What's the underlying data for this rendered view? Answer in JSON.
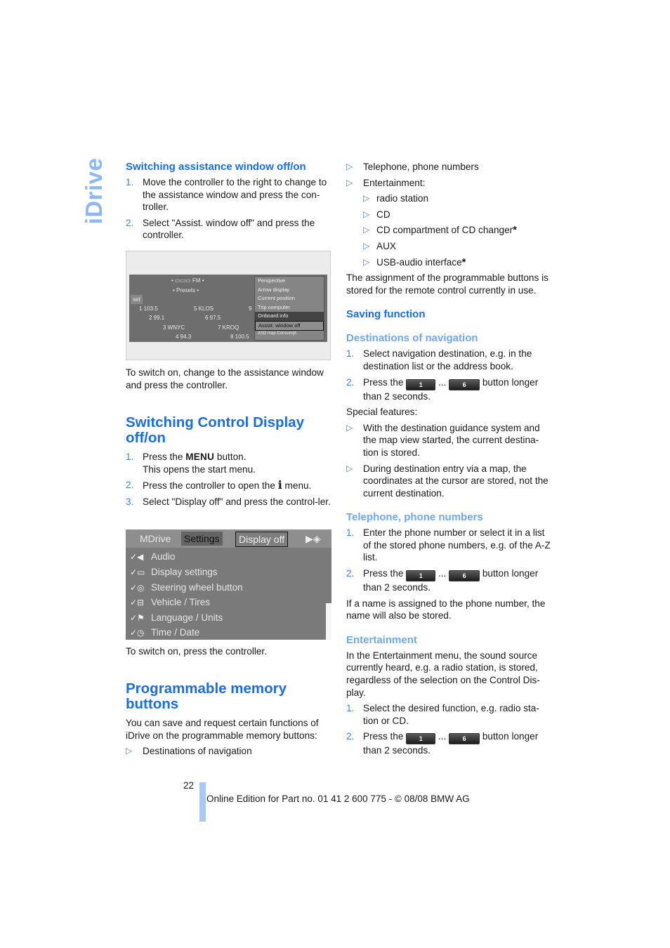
{
  "side_tab": "iDrive",
  "left": {
    "assist_heading": "Switching assistance window off/on",
    "assist_steps": [
      {
        "num": "1.",
        "text": "Move the controller to the right to change to the assistance window and press the con-troller."
      },
      {
        "num": "2.",
        "text": "Select \"Assist. window off\" and press the controller."
      }
    ],
    "screenshot1": {
      "top_bar": "FM",
      "presets_label": "• Presets •",
      "set_label": "set",
      "stations": [
        {
          "a": "1 103.5",
          "b": "5 KLOS",
          "c": "9"
        },
        {
          "a": "2 99.1",
          "b": "6 97.5",
          "c": ""
        },
        {
          "a": "3 WNYC",
          "b": "7 KROQ",
          "c": ""
        },
        {
          "a": "4 94.3",
          "b": "8 100.5",
          "c": ""
        }
      ],
      "menu": [
        "Perspective",
        "Arrow display",
        "Current position",
        "Trip computer",
        "Onboard info",
        "Assist. window off"
      ],
      "menu_footer": "ASD map  Consumpt."
    },
    "assist_caption": "To switch on, change to the assistance window and press the controller.",
    "display_heading": "Switching Control Display off/on",
    "display_steps": [
      {
        "num": "1.",
        "before": "Press the ",
        "key": "MENU",
        "after": " button.",
        "line2": "This opens the start menu."
      },
      {
        "num": "2.",
        "before": "Press the controller to open the ",
        "key": "i",
        "after": " menu."
      },
      {
        "num": "3.",
        "text": "Select \"Display off\" and press the control-ler."
      }
    ],
    "screenshot2": {
      "tabs": [
        "MDrive",
        "Settings",
        "Display off"
      ],
      "items": [
        {
          "icon": "audio-icon",
          "label": "Audio"
        },
        {
          "icon": "display-icon",
          "label": "Display settings"
        },
        {
          "icon": "steering-wheel-icon",
          "label": "Steering wheel button"
        },
        {
          "icon": "vehicle-icon",
          "label": "Vehicle / Tires"
        },
        {
          "icon": "language-icon",
          "label": "Language / Units"
        },
        {
          "icon": "clock-icon",
          "label": "Time / Date"
        }
      ]
    },
    "display_caption": "To switch on, press the controller.",
    "prog_heading": "Programmable memory buttons",
    "prog_intro": "You can save and request certain functions of iDrive on the programmable memory buttons:",
    "prog_bullets": [
      "Destinations of navigation"
    ]
  },
  "right": {
    "bullets": [
      "Telephone, phone numbers",
      "Entertainment:"
    ],
    "sub_bullets": [
      {
        "text": "radio station",
        "star": ""
      },
      {
        "text": "CD",
        "star": ""
      },
      {
        "text": "CD compartment of CD changer",
        "star": "*"
      },
      {
        "text": "AUX",
        "star": ""
      },
      {
        "text": "USB-audio interface",
        "star": "*"
      }
    ],
    "assignment_note": "The assignment of the programmable buttons is stored for the remote control currently in use.",
    "saving_heading": "Saving function",
    "nav": {
      "heading": "Destinations of navigation",
      "step1": "Select navigation destination, e.g. in the destination list or the address book.",
      "press_before": "Press the ",
      "key1": "1",
      "ellipsis": " ... ",
      "key6": "6",
      "press_after": " button longer than 2 seconds.",
      "special_label": "Special features:",
      "special": [
        "With the destination guidance system and the map view started, the current destina-tion is stored.",
        "During destination entry via a map, the coordinates at the cursor are stored, not the current destination."
      ]
    },
    "phone": {
      "heading": "Telephone, phone numbers",
      "step1": "Enter the phone number or select it in a list of the stored phone numbers, e.g. of the A-Z list.",
      "note": "If a name is assigned to the phone number, the name will also be stored."
    },
    "ent": {
      "heading": "Entertainment",
      "intro": "In the Entertainment menu, the sound source currently heard, e.g. a radio station, is stored, regardless of the selection on the Control Dis-play.",
      "step1": "Select the desired function, e.g. radio sta-tion or CD."
    }
  },
  "footer": {
    "page_number": "22",
    "edition": "Online Edition for Part no. 01 41 2 600 775 - © 08/08 BMW AG"
  }
}
